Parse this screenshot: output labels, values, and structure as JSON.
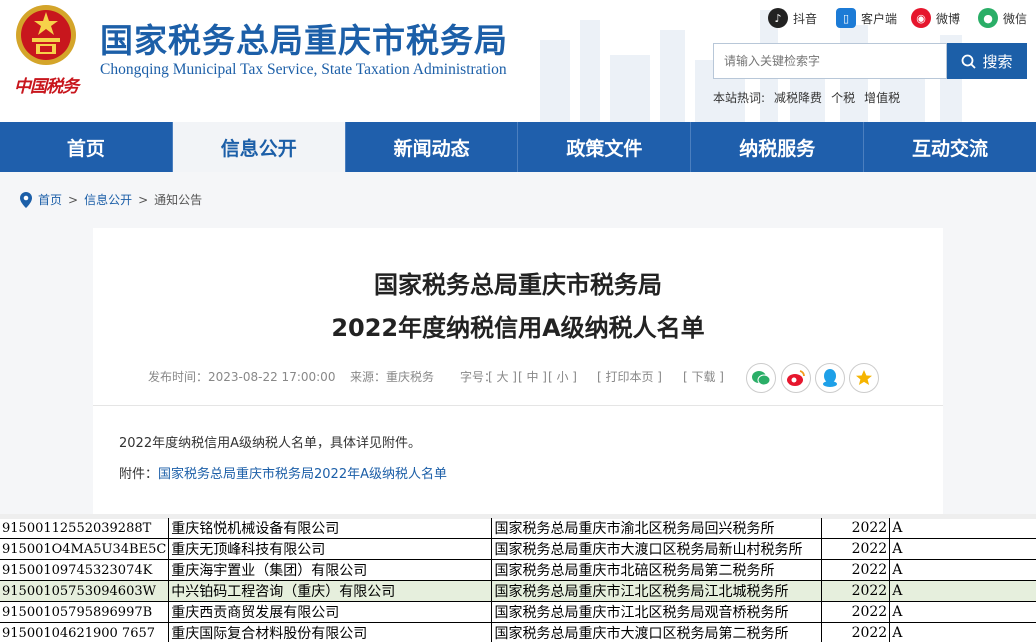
{
  "header": {
    "china_tax_text": "中国税务",
    "title": "国家税务总局重庆市税务局",
    "subtitle": "Chongqing Municipal Tax Service, State Taxation Administration",
    "social": [
      {
        "icon": "douyin-icon",
        "label": "抖音",
        "color": "#222222"
      },
      {
        "icon": "client-icon",
        "label": "客户端",
        "color": "#1c7bd6"
      },
      {
        "icon": "weibo-icon",
        "label": "微博",
        "color": "#e6162d"
      },
      {
        "icon": "wechat-icon",
        "label": "微信",
        "color": "#2aae67"
      }
    ],
    "search": {
      "placeholder": "请输入关键检索字",
      "button": "搜索"
    },
    "hot_label": "本站热词:",
    "hot_words": [
      "减税降费",
      "个税",
      "增值税"
    ]
  },
  "nav": {
    "items": [
      "首页",
      "信息公开",
      "新闻动态",
      "政策文件",
      "纳税服务",
      "互动交流"
    ],
    "active_index": 1
  },
  "breadcrumb": {
    "home": "首页",
    "sep": ">",
    "section": "信息公开",
    "current": "通知公告"
  },
  "article": {
    "title_line1": "国家税务总局重庆市税务局",
    "title_line2": "2022年度纳税信用A级纳税人名单",
    "publish_time": "发布时间：2023-08-22 17:00:00",
    "source": "来源：重庆税务",
    "font_size_label": "字号：",
    "font_large": "[ 大 ]",
    "font_mid": "[ 中 ]",
    "font_small": "[ 小 ]",
    "print": "[ 打印本页 ]",
    "download": "[ 下载 ]",
    "share_icons": [
      "wechat-share-icon",
      "weibo-share-icon",
      "qq-share-icon",
      "favorite-icon"
    ],
    "body_text": "2022年度纳税信用A级纳税人名单，具体详见附件。",
    "attachment_label": "附件：",
    "attachment_link": "国家税务总局重庆市税务局2022年A级纳税人名单"
  },
  "sheet": {
    "rows": [
      {
        "code": "91500112552039288T",
        "name": "重庆铭悦机械设备有限公司",
        "office": "国家税务总局重庆市渝北区税务局回兴税务所",
        "year": "2022",
        "grade": "A"
      },
      {
        "code": "915001O4MA5U34BE5C",
        "name": "重庆无顶峰科技有限公司",
        "office": "国家税务总局重庆市大渡口区税务局新山村税务所",
        "year": "2022",
        "grade": "A"
      },
      {
        "code": "91500109745323074K",
        "name": "重庆海宇置业（集团）有限公司",
        "office": "国家税务总局重庆市北碚区税务局第二税务所",
        "year": "2022",
        "grade": "A"
      },
      {
        "code": "91500105753094603W",
        "name": "中兴铂码工程咨询（重庆）有限公司",
        "office": "国家税务总局重庆市江北区税务局江北城税务所",
        "year": "2022",
        "grade": "A"
      },
      {
        "code": "91500105795896997B",
        "name": "重庆西贡商贸发展有限公司",
        "office": "国家税务总局重庆市江北区税务局观音桥税务所",
        "year": "2022",
        "grade": "A"
      },
      {
        "code": "91500104621900 7657",
        "name": "重庆国际复合材料股份有限公司",
        "office": "国家税务总局重庆市大渡口区税务局第二税务所",
        "year": "2022",
        "grade": "A"
      }
    ],
    "highlight_index": 3
  }
}
